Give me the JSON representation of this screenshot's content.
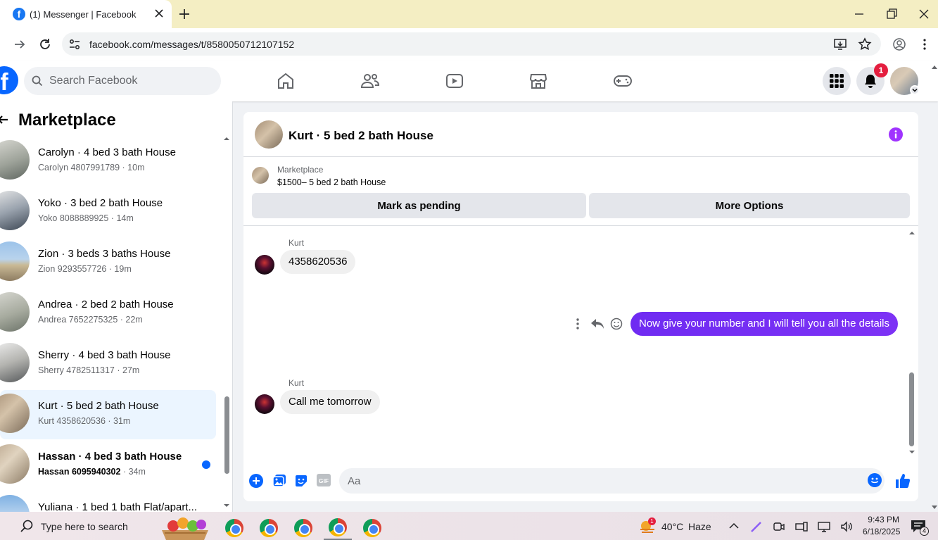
{
  "browser": {
    "tab_title": "(1) Messenger | Facebook",
    "url": "facebook.com/messages/t/8580050712107152"
  },
  "facebook": {
    "search_placeholder": "Search Facebook",
    "notification_count": "1"
  },
  "sidebar": {
    "title": "Marketplace",
    "conversations": [
      {
        "title": "Carolyn · 4 bed 3 bath House",
        "sub": "Carolyn 4807991789 · 10m",
        "unread": false,
        "selected": false
      },
      {
        "title": "Yoko · 3 bed 2 bath House",
        "sub": "Yoko 8088889925 · 14m",
        "unread": false,
        "selected": false
      },
      {
        "title": "Zion · 3 beds 3 baths House",
        "sub": "Zion 9293557726 · 19m",
        "unread": false,
        "selected": false
      },
      {
        "title": "Andrea · 2 bed 2 bath House",
        "sub": "Andrea 7652275325 · 22m",
        "unread": false,
        "selected": false
      },
      {
        "title": "Sherry · 4 bed 3 bath House",
        "sub": "Sherry 4782511317 · 27m",
        "unread": false,
        "selected": false
      },
      {
        "title": "Kurt · 5 bed 2 bath House",
        "sub": "Kurt 4358620536 · 31m",
        "unread": false,
        "selected": true
      },
      {
        "title": "Hassan · 4 bed 3 bath House",
        "sub_name": "Hassan 6095940302",
        "sub_time": " · 34m",
        "unread": true,
        "selected": false
      },
      {
        "title": "Yuliana · 1 bed 1 bath Flat/apart...",
        "sub": "",
        "unread": false,
        "selected": false
      }
    ]
  },
  "chat": {
    "header_title": "Kurt · 5 bed 2 bath House",
    "listing_label": "Marketplace",
    "listing_detail": "$1500– 5 bed 2 bath House",
    "mark_pending": "Mark as pending",
    "more_options": "More Options",
    "messages": [
      {
        "sender": "Kurt",
        "text": "4358620536",
        "direction": "in"
      },
      {
        "sender": "",
        "text": "Now give your number and I will tell you all the details",
        "direction": "out"
      },
      {
        "sender": "Kurt",
        "text": "Call me tomorrow",
        "direction": "in"
      }
    ],
    "composer_placeholder": "Aa",
    "gif_label": "GIF"
  },
  "taskbar": {
    "search_placeholder": "Type here to search",
    "weather_temp": "40°C",
    "weather_desc": "Haze",
    "weather_alert": "1",
    "time": "9:43 PM",
    "date": "6/18/2025",
    "notifications": "4"
  },
  "colors": {
    "facebook_blue": "#0866ff",
    "outgoing_bubble": "#7b2ff7",
    "selected_row": "#ebf5ff",
    "notification_red": "#e41e3f"
  }
}
